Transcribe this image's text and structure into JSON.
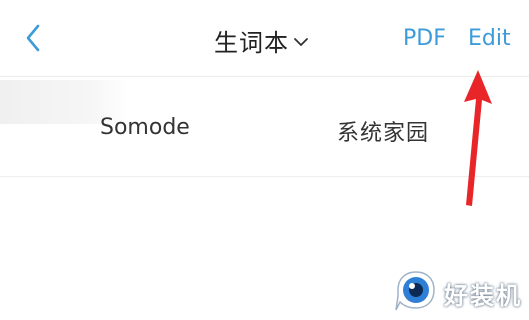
{
  "header": {
    "back_icon": "chevron-left-icon",
    "title": "生词本",
    "title_dropdown_icon": "chevron-down-icon",
    "pdf_label": "PDF",
    "edit_label": "Edit",
    "accent_color": "#3d9bd9"
  },
  "word_list": {
    "rows": [
      {
        "word": "Somode",
        "meaning": "系统家园"
      }
    ]
  },
  "annotation": {
    "arrow_icon": "red-arrow-icon",
    "arrow_color": "#e8262a"
  },
  "watermark": {
    "logo_icon": "eye-logo-icon",
    "text": "好装机"
  }
}
